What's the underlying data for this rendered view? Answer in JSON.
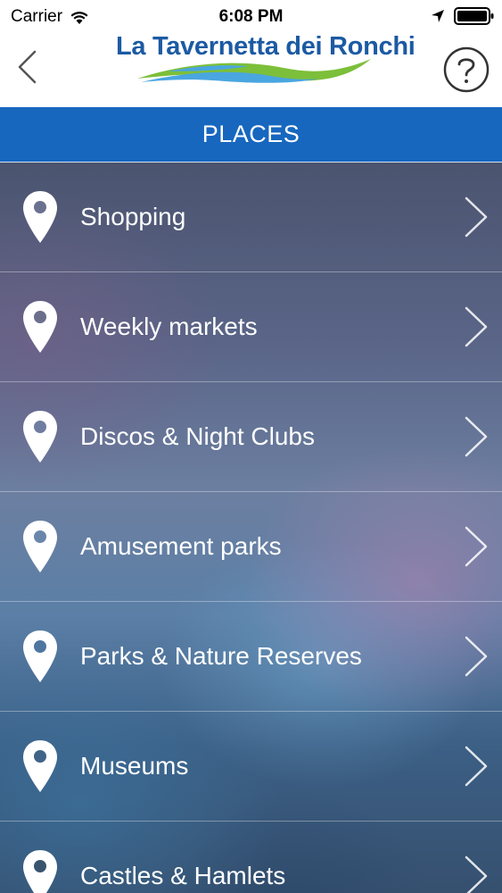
{
  "status_bar": {
    "carrier": "Carrier",
    "time": "6:08 PM"
  },
  "header": {
    "logo_text": "La Tavernetta dei Ronchi",
    "back_icon": "chevron-left-icon",
    "help_icon": "question-circle-icon"
  },
  "title": "PLACES",
  "colors": {
    "title_bar": "#1767bf",
    "logo_blue": "#1c5aa3",
    "logo_green": "#7cbf3a",
    "logo_light_blue": "#4aa6e0"
  },
  "list": {
    "items": [
      {
        "label": "Shopping",
        "icon": "map-pin-icon"
      },
      {
        "label": "Weekly markets",
        "icon": "map-pin-icon"
      },
      {
        "label": "Discos & Night Clubs",
        "icon": "map-pin-icon"
      },
      {
        "label": "Amusement parks",
        "icon": "map-pin-icon"
      },
      {
        "label": "Parks & Nature Reserves",
        "icon": "map-pin-icon"
      },
      {
        "label": "Museums",
        "icon": "map-pin-icon"
      },
      {
        "label": "Castles & Hamlets",
        "icon": "map-pin-icon"
      }
    ]
  }
}
